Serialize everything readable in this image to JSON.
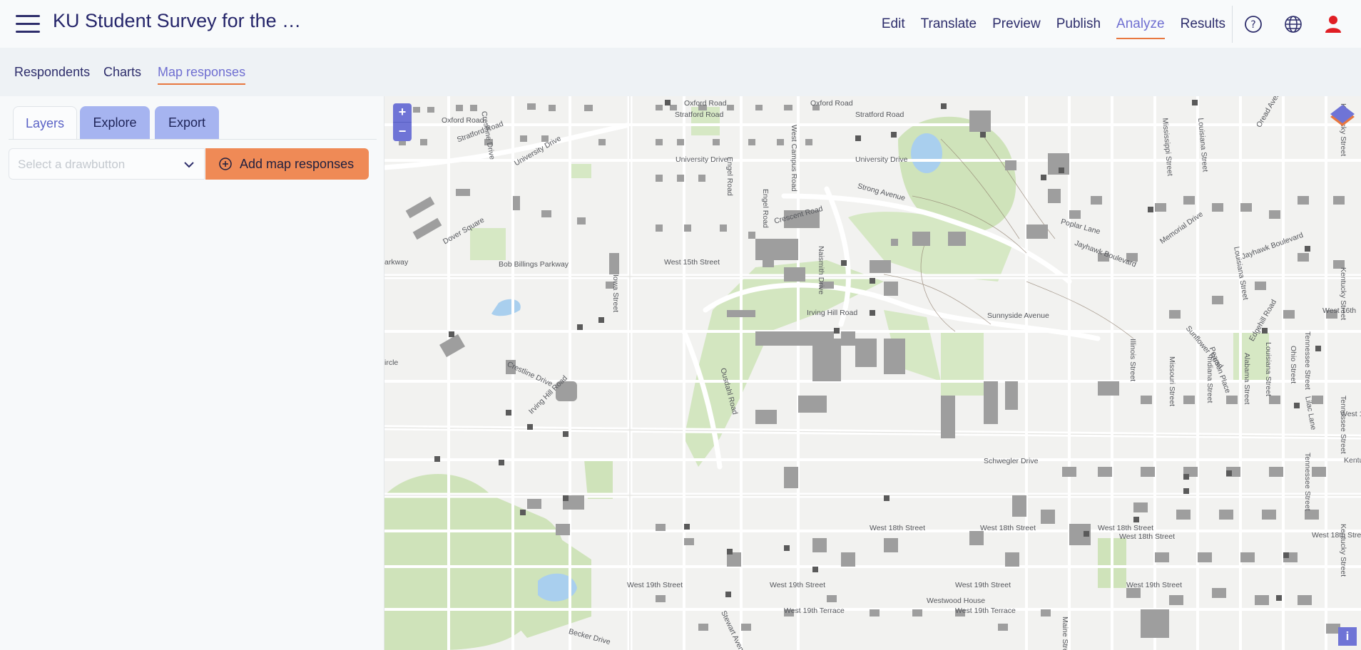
{
  "header": {
    "title": "KU Student Survey for the …",
    "nav": [
      "Edit",
      "Translate",
      "Preview",
      "Publish",
      "Analyze",
      "Results"
    ],
    "active_nav": "Analyze",
    "icons": [
      "help-icon",
      "globe-icon",
      "user-icon"
    ]
  },
  "subnav": {
    "items": [
      "Respondents",
      "Charts",
      "Map responses"
    ],
    "active": "Map responses"
  },
  "panel": {
    "tabs": [
      "Layers",
      "Explore",
      "Export"
    ],
    "active_tab": "Layers",
    "select_placeholder": "Select a drawbutton",
    "add_button": "Add map responses"
  },
  "map": {
    "zoom_in": "+",
    "zoom_out": "−",
    "info": "i",
    "street_labels": [
      "Oxford Road",
      "Oxford Road",
      "Oxford Road",
      "Stratford Road",
      "Stratford Road",
      "Stratford Road",
      "Crestline Drive",
      "University Drive",
      "University Drive",
      "University Drive",
      "Engel Road",
      "Strong Avenue",
      "West Campus Road",
      "Mississippi Street",
      "Louisiana Street",
      "Oread Avenue",
      "Louisiana Street",
      "Poplar Lane",
      "Jayhawk Boulevard",
      "Memorial Drive",
      "Jayhawk Boulevard",
      "Crescent Road",
      "Naismith Drive",
      "Dover Square",
      "West 15th Street",
      "Bob Billings Parkway",
      "arkway",
      "Iowa Street",
      "Irving Hill Road",
      "Sunnyside Avenue",
      "Sunflower Road",
      "Illinois Street",
      "Louisiana Street",
      "Edgehill Road",
      "West 16th",
      "Crestline Drive",
      "Irving Hill Road",
      "Ousdahl Road",
      "Schwegler Drive",
      "Alabama Street",
      "Missouri Street",
      "Indiana Street",
      "Ohio Street",
      "Tennessee Street",
      "West 18th Street",
      "West 18th Street",
      "West 18th Street",
      "West 18th Street",
      "West 19th Street",
      "West 19th Street",
      "West 19th Street",
      "West 19th Street",
      "Westwood House",
      "West 19th Terrace",
      "West 19th Terrace",
      "Becker Drive",
      "Maine Street",
      "Stewart Avenue",
      "Lilac Lane",
      "Pearson Place",
      "Tennessee Street",
      "Kentucky Street",
      "Kentucky Street",
      "Kentucky Street",
      "Tennessee Street",
      "Engel Road",
      "West 18th Street",
      "ircle",
      "West 18t",
      "Kentucky"
    ]
  }
}
